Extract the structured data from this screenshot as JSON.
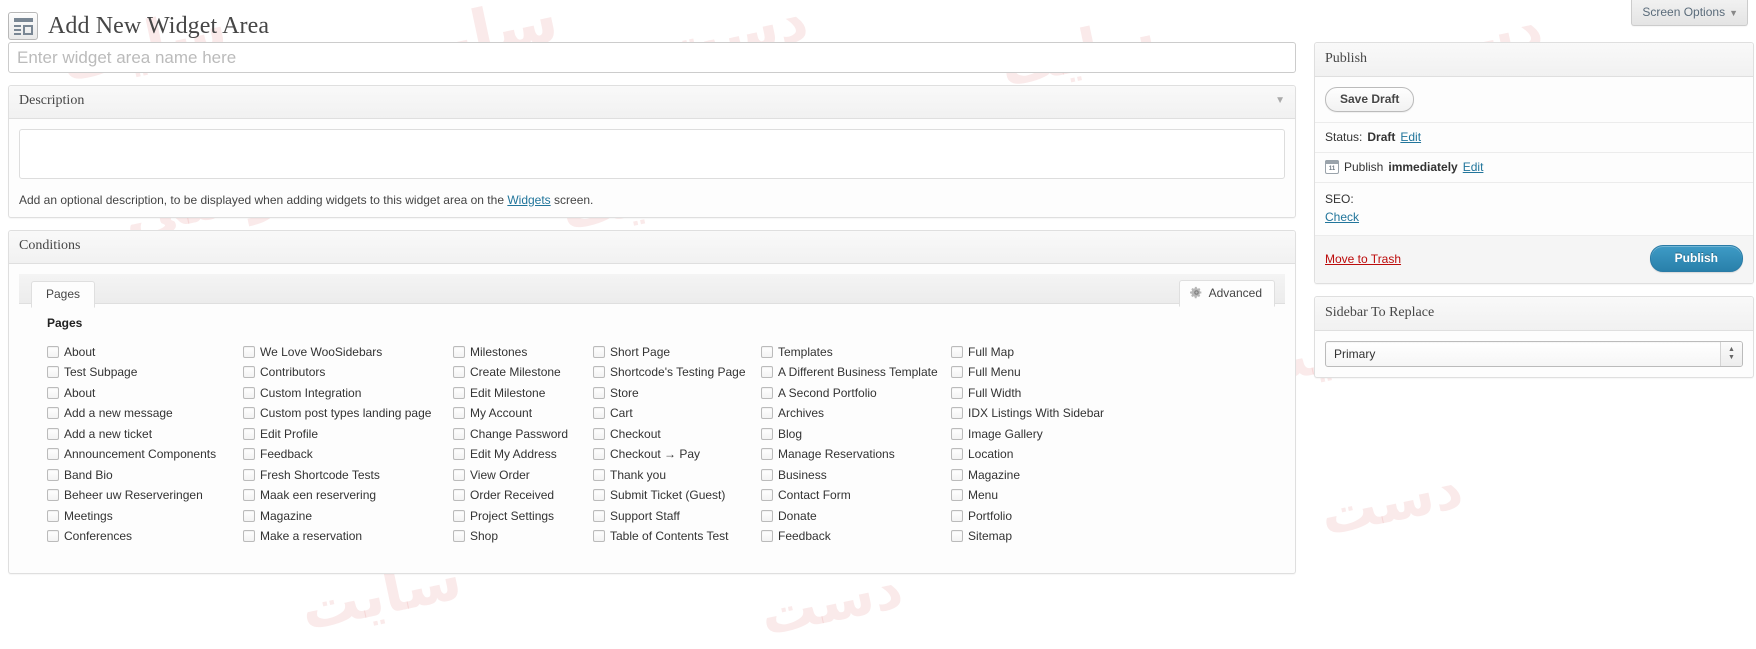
{
  "screen_options": {
    "label": "Screen Options",
    "caret": "▼"
  },
  "header": {
    "title": "Add New Widget Area",
    "icon": "widget-area-icon"
  },
  "title_field": {
    "placeholder": "Enter widget area name here",
    "value": ""
  },
  "description": {
    "panel_title": "Description",
    "toggle_icon": "▼",
    "textarea_value": "",
    "help_prefix": "Add an optional description, to be displayed when adding widgets to this widget area on the ",
    "help_link": "Widgets",
    "help_suffix": " screen."
  },
  "conditions": {
    "panel_title": "Conditions",
    "tab_label": "Pages",
    "advanced_label": "Advanced",
    "section_heading": "Pages",
    "columns": [
      {
        "items": [
          "About",
          "Test Subpage",
          "About",
          "Add a new message",
          "Add a new ticket",
          "Announcement Components",
          "Band Bio",
          "Beheer uw Reserveringen",
          "Meetings",
          "Conferences"
        ]
      },
      {
        "items": [
          "We Love WooSidebars",
          "Contributors",
          "Custom Integration",
          "Custom post types landing page",
          "Edit Profile",
          "Feedback",
          "Fresh Shortcode Tests",
          "Maak een reservering",
          "Magazine",
          "Make a reservation"
        ]
      },
      {
        "items": [
          "Milestones",
          "Create Milestone",
          "Edit Milestone",
          "My Account",
          "Change Password",
          "Edit My Address",
          "View Order",
          "Order Received",
          "Project Settings",
          "Shop"
        ]
      },
      {
        "items": [
          "Short Page",
          "Shortcode's Testing Page",
          "Store",
          "Cart",
          "Checkout",
          "Checkout → Pay",
          "Thank you",
          "Submit Ticket (Guest)",
          "Support Staff",
          "Table of Contents Test"
        ]
      },
      {
        "items": [
          "Templates",
          "A Different Business Template",
          "A Second Portfolio",
          "Archives",
          "Blog",
          "Manage Reservations",
          "Business",
          "Contact Form",
          "Donate",
          "Feedback"
        ]
      },
      {
        "items": [
          "Full Map",
          "Full Menu",
          "Full Width",
          "IDX Listings With Sidebar",
          "Image Gallery",
          "Location",
          "Magazine",
          "Menu",
          "Portfolio",
          "Sitemap"
        ]
      }
    ]
  },
  "publish": {
    "panel_title": "Publish",
    "save_draft_label": "Save Draft",
    "status_label": "Status:",
    "status_value": "Draft",
    "status_edit": "Edit",
    "publish_label": "Publish",
    "publish_value": "immediately",
    "publish_edit": "Edit",
    "calendar_day": "11",
    "seo_label": "SEO:",
    "seo_link": "Check",
    "trash_label": "Move to Trash",
    "publish_button": "Publish"
  },
  "sidebar_replace": {
    "panel_title": "Sidebar To Replace",
    "selected": "Primary"
  },
  "colors": {
    "accent": "#21759b",
    "publish_button": "#2980aa",
    "trash": "#bc0b0b"
  }
}
